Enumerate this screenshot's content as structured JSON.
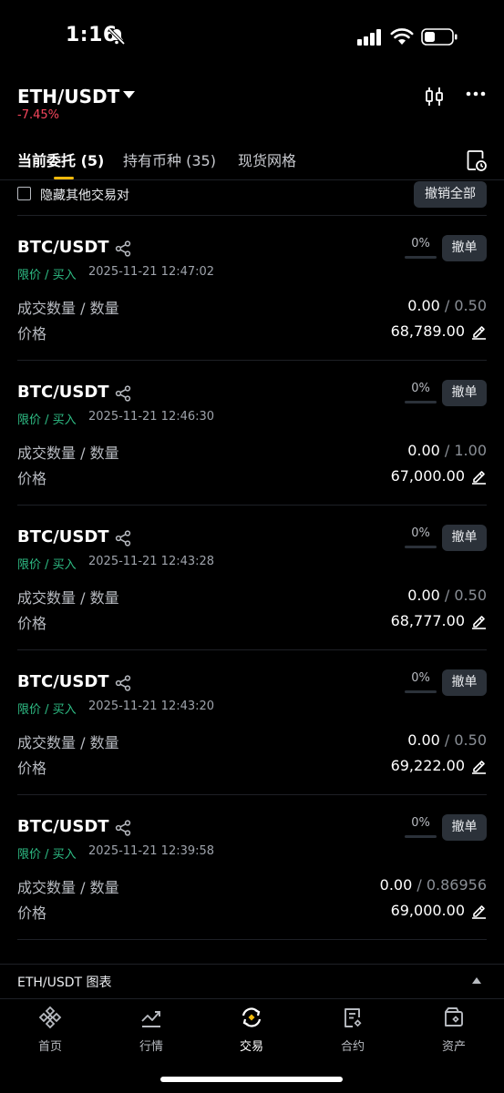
{
  "status_bar": {
    "time": "1:16"
  },
  "header": {
    "pair": "ETH/USDT",
    "change": "-7.45%"
  },
  "tabs": [
    {
      "label": "当前委托 (5)"
    },
    {
      "label": "持有币种 (35)"
    },
    {
      "label": "现货网格"
    }
  ],
  "filter": {
    "hide_label": "隐藏其他交易对",
    "cancel_all": "撤销全部"
  },
  "labels": {
    "qty": "成交数量 / 数量",
    "price": "价格",
    "cancel": "撤单",
    "sep": " / "
  },
  "orders": [
    {
      "pair": "BTC/USDT",
      "type": "限价 / 买入",
      "time": "2025-11-21 12:47:02",
      "progress": "0%",
      "filled": "0.00",
      "total": "0.50",
      "price": "68,789.00"
    },
    {
      "pair": "BTC/USDT",
      "type": "限价 / 买入",
      "time": "2025-11-21 12:46:30",
      "progress": "0%",
      "filled": "0.00",
      "total": "1.00",
      "price": "67,000.00"
    },
    {
      "pair": "BTC/USDT",
      "type": "限价 / 买入",
      "time": "2025-11-21 12:43:28",
      "progress": "0%",
      "filled": "0.00",
      "total": "0.50",
      "price": "68,777.00"
    },
    {
      "pair": "BTC/USDT",
      "type": "限价 / 买入",
      "time": "2025-11-21 12:43:20",
      "progress": "0%",
      "filled": "0.00",
      "total": "0.50",
      "price": "69,222.00"
    },
    {
      "pair": "BTC/USDT",
      "type": "限价 / 买入",
      "time": "2025-11-21 12:39:58",
      "progress": "0%",
      "filled": "0.00",
      "total": "0.86956",
      "price": "69,000.00"
    }
  ],
  "chart_bar": {
    "label": "ETH/USDT 图表"
  },
  "bottom_nav": [
    {
      "label": "首页",
      "icon": "binance-logo-icon"
    },
    {
      "label": "行情",
      "icon": "market-chart-icon"
    },
    {
      "label": "交易",
      "icon": "trade-swap-icon"
    },
    {
      "label": "合约",
      "icon": "futures-document-icon"
    },
    {
      "label": "资产",
      "icon": "wallet-icon"
    }
  ],
  "colors": {
    "accent": "#f0b90b",
    "buy": "#2ebd85",
    "sell": "#f6465d",
    "background": "#000000"
  }
}
